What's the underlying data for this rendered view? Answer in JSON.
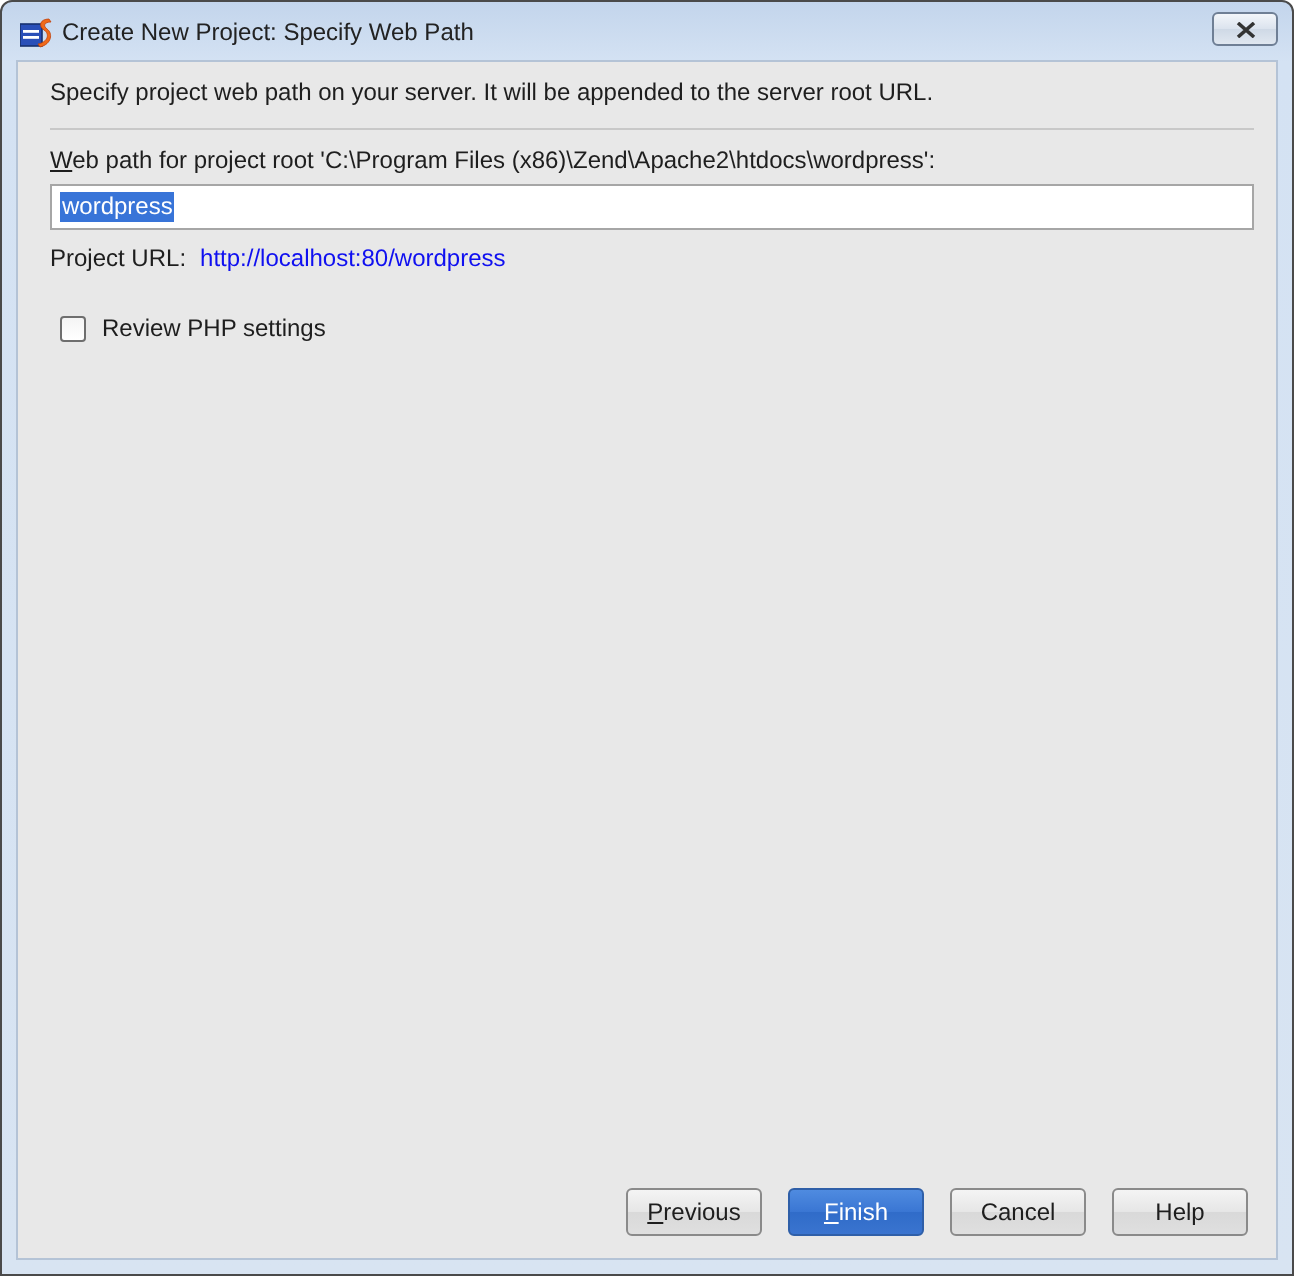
{
  "window": {
    "title": "Create New Project: Specify Web Path"
  },
  "description": "Specify project web path on your server. It will be appended to the server root URL.",
  "web_path": {
    "label": "Web path for project root 'C:\\Program Files (x86)\\Zend\\Apache2\\htdocs\\wordpress':",
    "mnemonic": true,
    "value": "wordpress",
    "value_selected": true
  },
  "project_url": {
    "label": "Project URL:",
    "link": "http://localhost:80/wordpress"
  },
  "review_php_settings": {
    "label": "Review PHP settings",
    "checked": false
  },
  "buttons": [
    {
      "label": "Previous",
      "mnemonic": true,
      "default": false
    },
    {
      "label": "Finish",
      "mnemonic": true,
      "default": true
    },
    {
      "label": "Cancel",
      "mnemonic": false,
      "default": false
    },
    {
      "label": "Help",
      "mnemonic": false,
      "default": false
    }
  ]
}
